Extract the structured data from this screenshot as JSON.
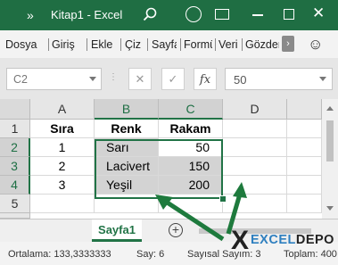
{
  "titlebar": {
    "qat_icon": "double-chevron-icon",
    "qat_glyph": "»",
    "title": "Kitap1 - Excel",
    "close_glyph": "✕"
  },
  "ribbon": {
    "tabs": [
      "Dosya",
      "Giriş",
      "Ekle",
      "Çiz",
      "Sayfa",
      "Formü",
      "Veri",
      "Gözden"
    ],
    "more_glyph": "›",
    "feedback_glyph": "☺"
  },
  "formula_bar": {
    "name_box": "C2",
    "dots": "⋮",
    "cancel_glyph": "✕",
    "enter_glyph": "✓",
    "fx_label": "fx",
    "value": "50"
  },
  "grid": {
    "columns": [
      "A",
      "B",
      "C",
      "D"
    ],
    "rows": [
      "1",
      "2",
      "3",
      "4",
      "5"
    ],
    "cells": [
      [
        "Sıra",
        "Renk",
        "Rakam",
        ""
      ],
      [
        "1",
        "Sarı",
        "50",
        ""
      ],
      [
        "2",
        "Lacivert",
        "150",
        ""
      ],
      [
        "3",
        "Yeşil",
        "200",
        ""
      ],
      [
        "",
        "",
        "",
        ""
      ]
    ]
  },
  "sheets": {
    "active": "Sayfa1",
    "add_glyph": "+"
  },
  "status": {
    "average": "Ortalama: 133,3333333",
    "count": "Say: 6",
    "numeric_count": "Sayısal Sayım: 3",
    "sum": "Toplam: 400"
  },
  "watermark": {
    "mark": "X",
    "part1": "EXCEL",
    "part2": "DEPO"
  },
  "colors": {
    "accent": "#217346",
    "titlebar": "#1f6e43",
    "arrow": "#1e7a3d"
  }
}
